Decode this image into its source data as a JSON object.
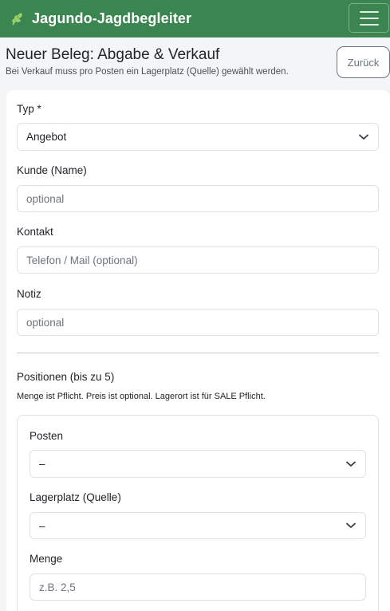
{
  "navbar": {
    "brand": "Jagundo-Jagdbegleiter",
    "brand_icon": "leaf-icon",
    "menu_icon": "hamburger-menu-icon",
    "color": "#3b8550"
  },
  "header": {
    "title": "Neuer Beleg: Abgabe & Verkauf",
    "subtitle": "Bei Verkauf muss pro Posten ein Lagerplatz (Quelle) gewählt werden.",
    "back_label": "Zurück"
  },
  "form": {
    "typ": {
      "label": "Typ *",
      "value": "Angebot"
    },
    "kunde": {
      "label": "Kunde (Name)",
      "placeholder": "optional"
    },
    "kontakt": {
      "label": "Kontakt",
      "placeholder": "Telefon / Mail (optional)"
    },
    "notiz": {
      "label": "Notiz",
      "placeholder": "optional"
    }
  },
  "positionen": {
    "title": "Positionen (bis zu 5)",
    "hint": "Menge ist Pflicht. Preis ist optional. Lagerort ist für SALE Pflicht.",
    "posten": {
      "label": "Posten",
      "value": "–"
    },
    "lagerplatz": {
      "label": "Lagerplatz (Quelle)",
      "value": "–"
    },
    "menge": {
      "label": "Menge",
      "placeholder": "z.B. 2,5"
    }
  }
}
